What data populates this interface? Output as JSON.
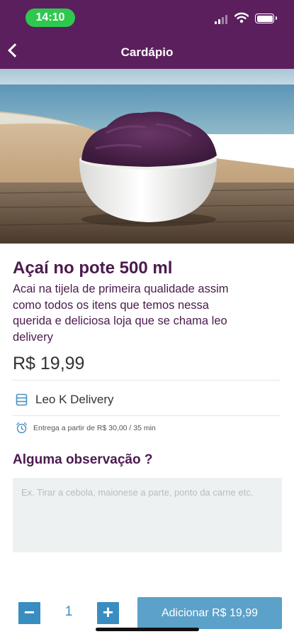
{
  "status_bar": {
    "time": "14:10"
  },
  "header": {
    "title": "Cardápio"
  },
  "icons": {
    "back": "chevron-left-icon",
    "signal": "cellular-signal-icon",
    "wifi": "wifi-icon",
    "battery": "battery-icon",
    "store": "store-icon",
    "clock": "alarm-clock-icon",
    "minus": "minus-icon",
    "plus": "plus-icon"
  },
  "product": {
    "name": "Açaí no pote 500 ml",
    "description": "Acai na tijela de primeira qualidade assim como todos os itens que temos nessa querida e deliciosa loja que se chama leo delivery",
    "price": "R$ 19,99"
  },
  "store": {
    "name": "Leo K Delivery"
  },
  "delivery": {
    "info": "Entrega a partir de R$ 30,00 / 35 min"
  },
  "observation": {
    "title": "Alguma observação ?",
    "placeholder": "Ex. Tirar a cebola, maionese a parte, ponto da carne etc.",
    "value": ""
  },
  "cart": {
    "quantity": "1",
    "minus_label": "−",
    "plus_label": "+",
    "add_label": "Adicionar R$ 19,99"
  },
  "colors": {
    "header": "#5b1f5e",
    "title_text": "#4b1a4e",
    "accent_blue": "#3a8dc0",
    "add_button": "#5ba1c9",
    "time_pill": "#2fc84f",
    "input_bg": "#edf1f1"
  }
}
